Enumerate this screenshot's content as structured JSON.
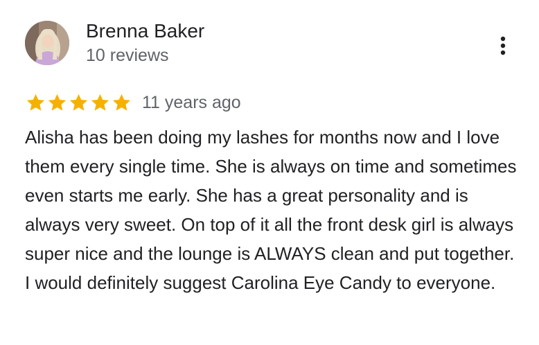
{
  "reviewer": {
    "name": "Brenna Baker",
    "review_count": "10 reviews",
    "avatar_icon": "profile-photo"
  },
  "menu": {
    "icon": "more-vert-icon"
  },
  "rating": {
    "stars": 5,
    "max_stars": 5,
    "star_color": "#f6b100",
    "date": "11 years ago"
  },
  "review": {
    "text": "Alisha has been doing my lashes for months now and I love them every single time. She is always on time and sometimes even starts me early. She has a great personality and is always very sweet. On top of it all the front desk girl is always super nice and the lounge is ALWAYS clean and put together. I would definitely suggest Carolina Eye Candy to everyone."
  }
}
